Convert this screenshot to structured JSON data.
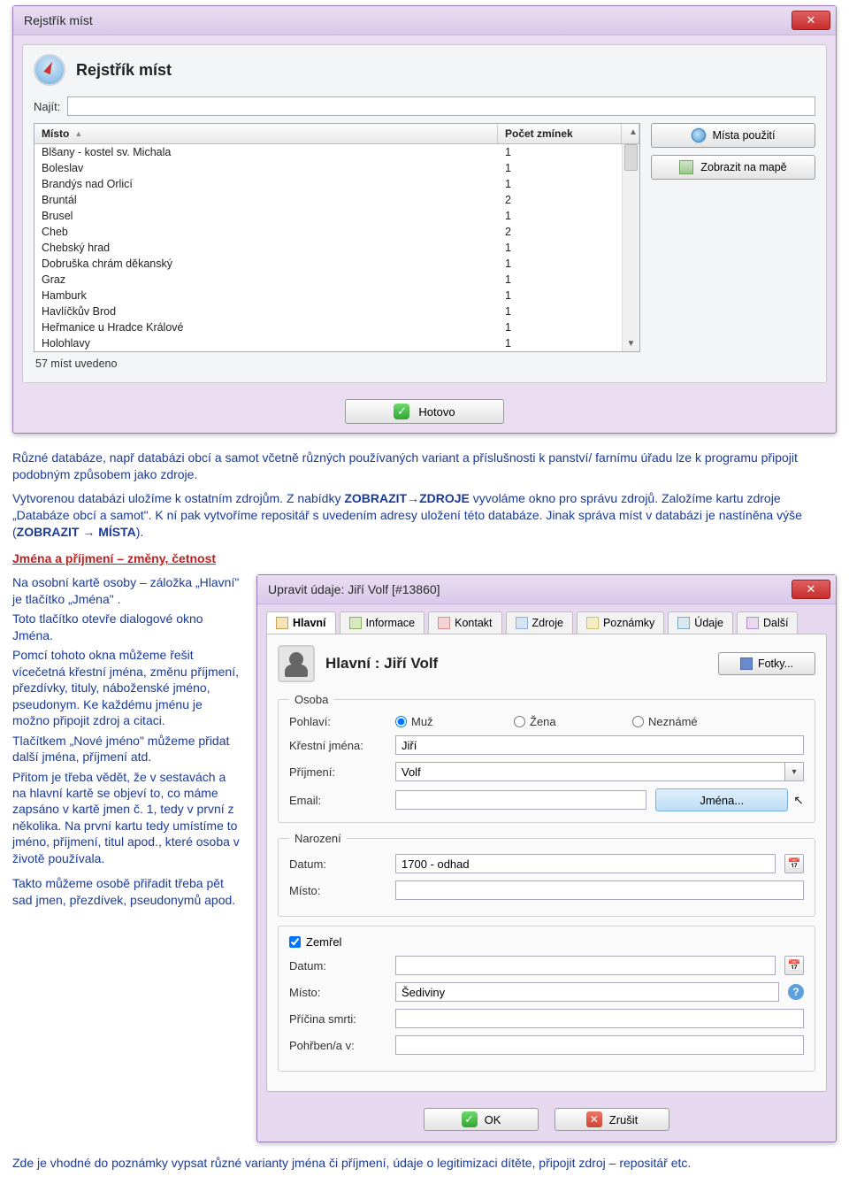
{
  "dlg1": {
    "title": "Rejstřík míst",
    "header": "Rejstřík míst",
    "search_label": "Najít:",
    "col_place": "Místo",
    "col_count": "Počet zmínek",
    "rows": [
      {
        "place": "Blšany - kostel sv. Michala",
        "count": "1"
      },
      {
        "place": "Boleslav",
        "count": "1"
      },
      {
        "place": "Brandýs nad Orlicí",
        "count": "1"
      },
      {
        "place": "Bruntál",
        "count": "2"
      },
      {
        "place": "Brusel",
        "count": "1"
      },
      {
        "place": "Cheb",
        "count": "2"
      },
      {
        "place": "Chebský hrad",
        "count": "1"
      },
      {
        "place": "Dobruška chrám děkanský",
        "count": "1"
      },
      {
        "place": "Graz",
        "count": "1"
      },
      {
        "place": "Hamburk",
        "count": "1"
      },
      {
        "place": "Havlíčkův Brod",
        "count": "1"
      },
      {
        "place": "Heřmanice u Hradce Králové",
        "count": "1"
      },
      {
        "place": "Holohlavy",
        "count": "1"
      }
    ],
    "status": "57 míst uvedeno",
    "btn_places": "Místa použití",
    "btn_map": "Zobrazit na mapě",
    "btn_done": "Hotovo"
  },
  "para1": {
    "t1": "Různé databáze, např databázi obcí a samot včetně různých používaných variant a příslušnosti k panství/ farnímu úřadu lze k programu připojit podobným způsobem jako zdroje.",
    "t2a": "Vytvorenou databázi uložíme k ostatním zdrojům. Z nabídky ",
    "t2b": "ZOBRAZIT→ZDROJE",
    "t2c": " vyvoláme okno pro správu zdrojů. Založíme kartu zdroje „Databáze obcí a samot\". K ní pak vytvoříme repositář s uvedením adresy uložení této databáze. Jinak správa míst v databázi je nastíněna výše (",
    "t2d": "ZOBRAZIT → MÍSTA",
    "t2e": ")."
  },
  "section_heading": "Jména a příjmení – změny, četnost",
  "left": {
    "p1a": "Na osobní kartě osoby – záložka „",
    "p1b": "Hlavní",
    "p1c": "\" je tlačítko „",
    "p1d": "Jména",
    "p1e": "\" .",
    "p2a": "Toto tlačítko otevře dialogové okno ",
    "p2b": "Jména",
    "p2c": ".",
    "p3a": "Pomcí tohoto okna můžeme řešit vícečetná křestní jména, změnu příjmení, přezdívky, tituly, náboženské jméno, pseudonym. Ke každému jménu je možno připojit zdroj a citaci.",
    "p4a": "Tlačítkem „",
    "p4b": "Nové jméno",
    "p4c": "\" můžeme přidat další jména, příjmení atd.",
    "p5": "Přitom je třeba vědět, že v sestavách a na hlavní kartě se objeví to, co máme zapsáno v kartě jmen č. 1, tedy v první z několika. Na první kartu tedy umístíme to jméno, příjmení, titul apod., které osoba v životě používala.",
    "p6": "Takto můžeme osobě přiřadit třeba pět sad jmen, přezdívek, pseudonymů apod."
  },
  "dlg2": {
    "title": "Upravit údaje: Jiří Volf [#13860]",
    "tabs": [
      "Hlavní",
      "Informace",
      "Kontakt",
      "Zdroje",
      "Poznámky",
      "Údaje",
      "Další"
    ],
    "panel_title": "Hlavní : Jiří Volf",
    "btn_fotky": "Fotky...",
    "fs_osoba": "Osoba",
    "lbl_gender": "Pohlaví:",
    "gender_opts": [
      "Muž",
      "Žena",
      "Neznámé"
    ],
    "lbl_first": "Křestní jména:",
    "val_first": "Jiří",
    "lbl_last": "Příjmení:",
    "val_last": "Volf",
    "lbl_email": "Email:",
    "btn_jmena": "Jména...",
    "fs_birth": "Narození",
    "lbl_date": "Datum:",
    "val_bdate": "1700 - odhad",
    "lbl_place": "Místo:",
    "chk_dead": "Zemřel",
    "lbl_ddate": "Datum:",
    "lbl_dplace": "Místo:",
    "val_dplace": "Šediviny",
    "lbl_cause": "Příčina smrti:",
    "lbl_burial": "Pohřben/a v:",
    "btn_ok": "OK",
    "btn_cancel": "Zrušit"
  },
  "footer_text": "Zde je vhodné do poznámky vypsat různé varianty jména či příjmení, údaje o legitimizaci dítěte, připojit zdroj – repositář etc."
}
